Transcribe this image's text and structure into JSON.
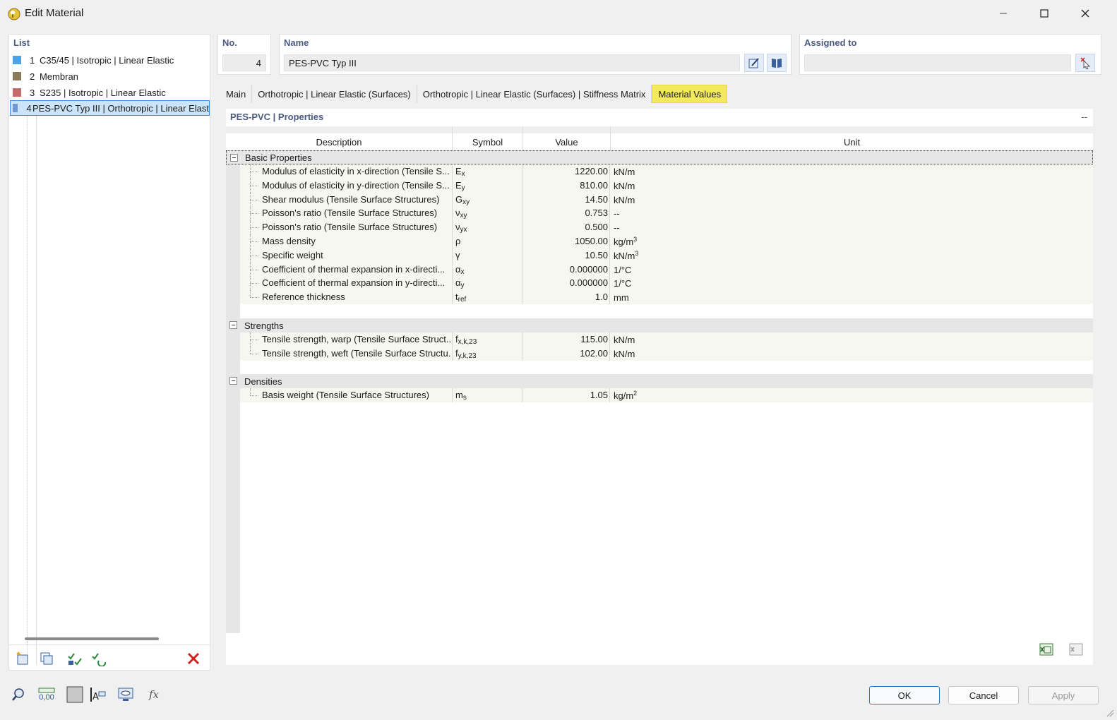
{
  "window": {
    "title": "Edit Material"
  },
  "list": {
    "header": "List",
    "items": [
      {
        "num": "1",
        "label": "C35/45 | Isotropic | Linear Elastic",
        "color": "#4aa3e8"
      },
      {
        "num": "2",
        "label": "Membran",
        "color": "#8b7a5a"
      },
      {
        "num": "3",
        "label": "S235 | Isotropic | Linear Elastic",
        "color": "#c46a6a"
      },
      {
        "num": "4",
        "label": "PES-PVC Typ III | Orthotropic | Linear Elast",
        "color": "#6e9ad1"
      }
    ]
  },
  "no": {
    "header": "No.",
    "value": "4"
  },
  "name": {
    "header": "Name",
    "value": "PES-PVC Typ III"
  },
  "assigned": {
    "header": "Assigned to",
    "value": ""
  },
  "tabs": [
    "Main",
    "Orthotropic | Linear Elastic (Surfaces)",
    "Orthotropic | Linear Elastic (Surfaces) | Stiffness Matrix",
    "Material Values"
  ],
  "section": {
    "title": "PES-PVC | Properties",
    "dash": "--"
  },
  "table": {
    "headers": {
      "description": "Description",
      "symbol": "Symbol",
      "value": "Value",
      "unit": "Unit"
    },
    "groups": [
      {
        "label": "Basic Properties",
        "rows": [
          {
            "desc": "Modulus of elasticity in x-direction (Tensile S...",
            "sym": "E",
            "sub": "x",
            "value": "1220.00",
            "unit": "kN/m",
            "sup": ""
          },
          {
            "desc": "Modulus of elasticity in y-direction (Tensile S...",
            "sym": "E",
            "sub": "y",
            "value": "810.00",
            "unit": "kN/m",
            "sup": ""
          },
          {
            "desc": "Shear modulus (Tensile Surface Structures)",
            "sym": "G",
            "sub": "xy",
            "value": "14.50",
            "unit": "kN/m",
            "sup": ""
          },
          {
            "desc": "Poisson's ratio (Tensile Surface Structures)",
            "sym": "ν",
            "sub": "xy",
            "value": "0.753",
            "unit": "--",
            "sup": ""
          },
          {
            "desc": "Poisson's ratio (Tensile Surface Structures)",
            "sym": "ν",
            "sub": "yx",
            "value": "0.500",
            "unit": "--",
            "sup": ""
          },
          {
            "desc": "Mass density",
            "sym": "ρ",
            "sub": "",
            "value": "1050.00",
            "unit": "kg/m",
            "sup": "3"
          },
          {
            "desc": "Specific weight",
            "sym": "γ",
            "sub": "",
            "value": "10.50",
            "unit": "kN/m",
            "sup": "3"
          },
          {
            "desc": "Coefficient of thermal expansion in x-directi...",
            "sym": "α",
            "sub": "x",
            "value": "0.000000",
            "unit": "1/°C",
            "sup": ""
          },
          {
            "desc": "Coefficient of thermal expansion in y-directi...",
            "sym": "α",
            "sub": "y",
            "value": "0.000000",
            "unit": "1/°C",
            "sup": ""
          },
          {
            "desc": "Reference thickness",
            "sym": "t",
            "sub": "ref",
            "value": "1.0",
            "unit": "mm",
            "sup": ""
          }
        ]
      },
      {
        "label": "Strengths",
        "rows": [
          {
            "desc": "Tensile strength, warp (Tensile Surface Struct...",
            "sym": "f",
            "sub": "x,k,23",
            "value": "115.00",
            "unit": "kN/m",
            "sup": ""
          },
          {
            "desc": "Tensile strength, weft (Tensile Surface Structu...",
            "sym": "f",
            "sub": "y,k,23",
            "value": "102.00",
            "unit": "kN/m",
            "sup": ""
          }
        ]
      },
      {
        "label": "Densities",
        "rows": [
          {
            "desc": "Basis weight (Tensile Surface Structures)",
            "sym": "m",
            "sub": "s",
            "value": "1.05",
            "unit": "kg/m",
            "sup": "2"
          }
        ]
      }
    ]
  },
  "buttons": {
    "ok": "OK",
    "cancel": "Cancel",
    "apply": "Apply"
  },
  "bottom_icons": {
    "units_label": "0,00",
    "formula_label": "fx"
  }
}
